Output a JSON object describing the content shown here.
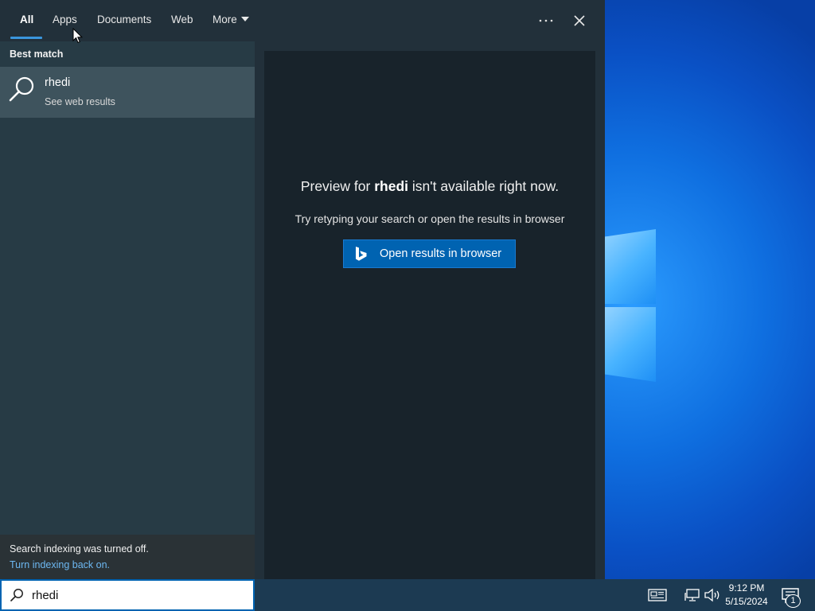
{
  "tabs": [
    {
      "label": "All"
    },
    {
      "label": "Apps"
    },
    {
      "label": "Documents"
    },
    {
      "label": "Web"
    },
    {
      "label": "More"
    }
  ],
  "top_actions": {
    "more_options_icon": "ellipsis-icon",
    "close_icon": "close-icon"
  },
  "left_pane": {
    "section_label": "Best match",
    "best_match": {
      "title": "rhedi",
      "subtitle": "See web results",
      "icon": "search-icon"
    },
    "indexing_notice": {
      "message": "Search indexing was turned off.",
      "link": "Turn indexing back on."
    }
  },
  "preview": {
    "title_prefix": "Preview for ",
    "title_query": "rhedi",
    "title_suffix": " isn't available right now.",
    "subtitle": "Try retyping your search or open the results in browser",
    "open_button": "Open results in browser",
    "open_button_icon": "bing-icon"
  },
  "taskbar": {
    "search_value": "rhedi",
    "tray_icons": [
      "news-icon",
      "network-icon",
      "volume-icon"
    ],
    "time": "9:12 PM",
    "date": "5/15/2024",
    "notification_count": "1"
  },
  "colors": {
    "accent": "#0063b1",
    "link": "#6db8f2",
    "left_pane": "#273b45",
    "preview_pane": "#18232b",
    "selected_item": "#3e535d"
  }
}
